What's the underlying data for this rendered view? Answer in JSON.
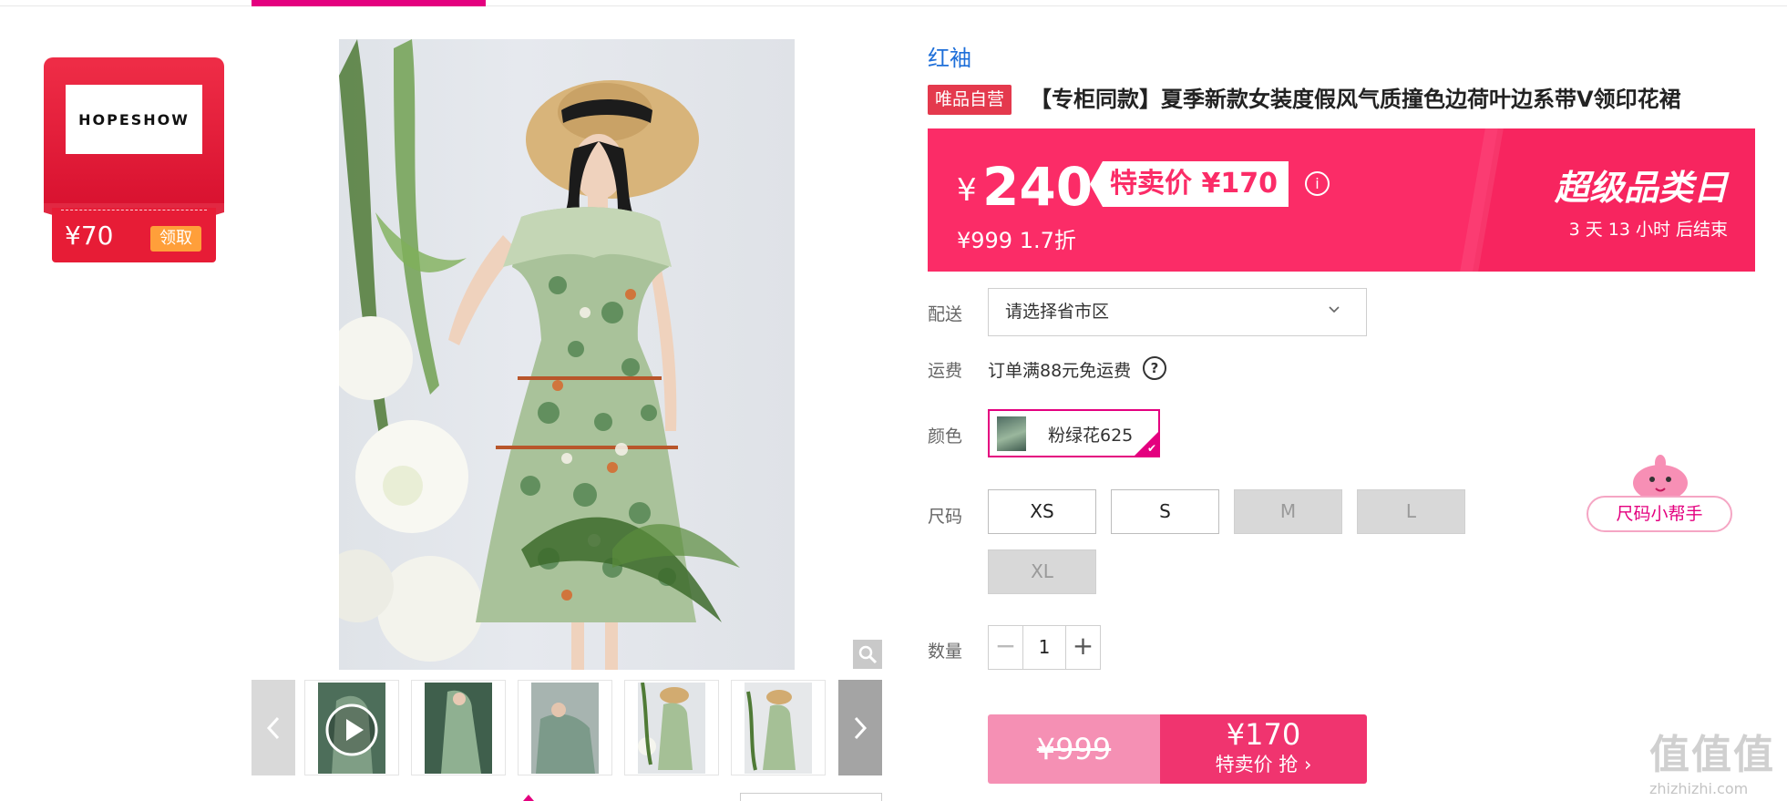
{
  "store": {
    "logo_text": "HOPESHOW",
    "coupon_amount": "¥70",
    "coupon_action": "领取"
  },
  "product": {
    "brand": "红袖",
    "self_operated_tag": "唯品自营",
    "title": "【专柜同款】夏季新款女装度假风气质撞色边荷叶边系带V领印花裙"
  },
  "price": {
    "currency_symbol": "¥",
    "current": "240",
    "special_label": "特卖价 ¥170",
    "original_and_discount": "¥999 1.7折",
    "promo_title": "超级品类日",
    "countdown": "3  天  13  小时 后结束"
  },
  "delivery": {
    "label": "配送",
    "select_placeholder": "请选择省市区"
  },
  "shipping": {
    "label": "运费",
    "text": "订单满88元免运费"
  },
  "color": {
    "label": "颜色",
    "selected": "粉绿花625"
  },
  "size": {
    "label": "尺码",
    "options": [
      {
        "label": "XS",
        "available": true
      },
      {
        "label": "S",
        "available": true
      },
      {
        "label": "M",
        "available": false
      },
      {
        "label": "L",
        "available": false
      },
      {
        "label": "XL",
        "available": false
      }
    ],
    "helper": "尺码小帮手"
  },
  "quantity": {
    "label": "数量",
    "value": "1",
    "minus": "−",
    "plus": "+"
  },
  "buy": {
    "original_price": "¥999",
    "special_price": "¥170",
    "action": "特卖价 抢 ›"
  },
  "watermark": {
    "glyphs": "值值值",
    "url": "zhizhizhi.com"
  },
  "colors": {
    "accent": "#e4007f",
    "price_banner": "#fb2c67",
    "brand_link": "#1e6fd9",
    "buy_right": "#f0346f",
    "buy_left": "#f590b4"
  }
}
